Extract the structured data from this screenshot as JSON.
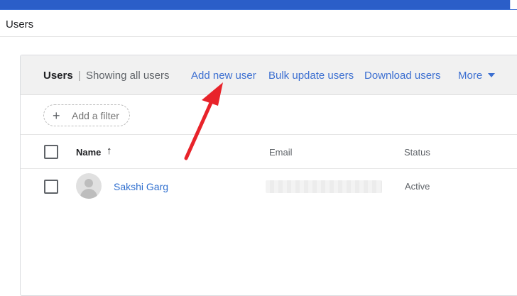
{
  "page": {
    "title": "Users"
  },
  "card": {
    "title_main": "Users",
    "title_separator": "|",
    "title_sub": "Showing all users",
    "actions": {
      "add_new_user": "Add new user",
      "bulk_update": "Bulk update users",
      "download": "Download users",
      "more": "More"
    }
  },
  "filter": {
    "plus_symbol": "+",
    "label": "Add a filter"
  },
  "table": {
    "columns": {
      "name": "Name",
      "email": "Email",
      "status": "Status"
    },
    "sort_symbol": "↑",
    "rows": [
      {
        "name": "Sakshi Garg",
        "email": "",
        "status": "Active"
      }
    ]
  },
  "colors": {
    "accent": "#3c6fd1",
    "annotation_arrow": "#e8232a"
  },
  "icons": {
    "more": "chevron-down-icon",
    "add_filter": "plus-icon",
    "sort": "arrow-up-icon",
    "avatar": "user-avatar-icon"
  }
}
